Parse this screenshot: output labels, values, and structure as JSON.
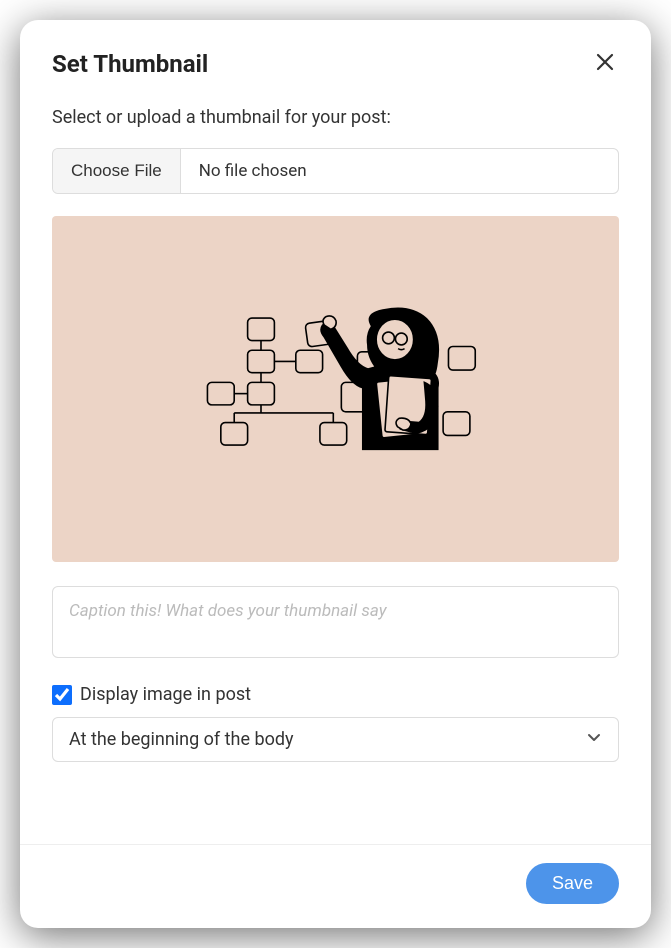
{
  "modal": {
    "title": "Set Thumbnail",
    "instruction": "Select or upload a thumbnail for your post:",
    "choose_label": "Choose File",
    "file_status": "No file chosen",
    "caption_placeholder": "Caption this! What does your thumbnail say",
    "caption_value": "",
    "display_checked": true,
    "display_label": "Display image in post",
    "position_selected": "At the beginning of the body",
    "save_label": "Save"
  },
  "colors": {
    "accent": "#0d6efd",
    "save_bg": "#4d94ea",
    "preview_bg": "#ecd4c6"
  }
}
